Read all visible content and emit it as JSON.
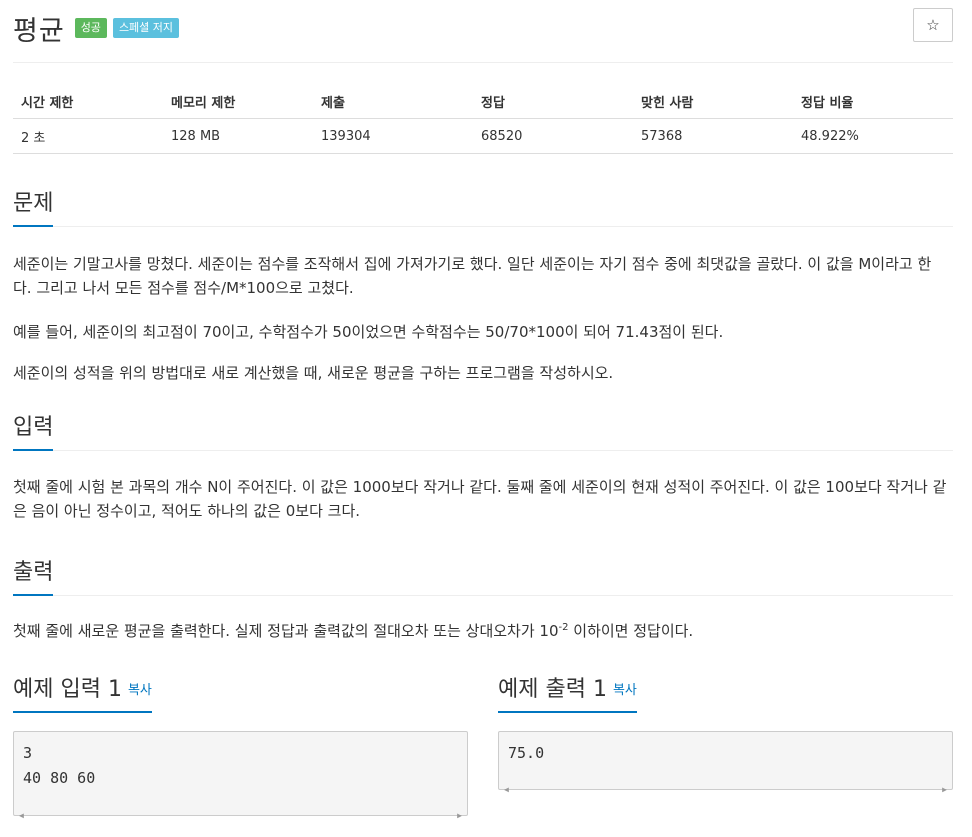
{
  "problem": {
    "title": "평균",
    "badges": {
      "success": "성공",
      "special_judge": "스페셜 저지"
    },
    "star_icon": "☆"
  },
  "info_table": {
    "headers": [
      "시간 제한",
      "메모리 제한",
      "제출",
      "정답",
      "맞힌 사람",
      "정답 비율"
    ],
    "values": [
      "2 초",
      "128 MB",
      "139304",
      "68520",
      "57368",
      "48.922%"
    ]
  },
  "sections": {
    "description": {
      "heading": "문제",
      "paragraphs": [
        "세준이는 기말고사를 망쳤다. 세준이는 점수를 조작해서 집에 가져가기로 했다. 일단 세준이는 자기 점수 중에 최댓값을 골랐다. 이 값을 M이라고 한다. 그리고 나서 모든 점수를 점수/M*100으로 고쳤다.",
        "예를 들어, 세준이의 최고점이 70이고, 수학점수가 50이었으면 수학점수는 50/70*100이 되어 71.43점이 된다.",
        "세준이의 성적을 위의 방법대로 새로 계산했을 때, 새로운 평균을 구하는 프로그램을 작성하시오."
      ]
    },
    "input": {
      "heading": "입력",
      "text": "첫째 줄에 시험 본 과목의 개수 N이 주어진다. 이 값은 1000보다 작거나 같다. 둘째 줄에 세준이의 현재 성적이 주어진다. 이 값은 100보다 작거나 같은 음이 아닌 정수이고, 적어도 하나의 값은 0보다 크다."
    },
    "output": {
      "heading": "출력",
      "text_before": "첫째 줄에 새로운 평균을 출력한다. 실제 정답과 출력값의 절대오차 또는 상대오차가 10",
      "exponent": "-2",
      "text_after": " 이하이면 정답이다."
    }
  },
  "samples": {
    "input": {
      "heading": "예제 입력 1",
      "copy_label": "복사",
      "content": "3\n40 80 60"
    },
    "output": {
      "heading": "예제 출력 1",
      "copy_label": "복사",
      "content": "75.0"
    }
  },
  "colors": {
    "accent": "#0076c0",
    "badge_success": "#5cb85c",
    "badge_info": "#5bc0de"
  }
}
